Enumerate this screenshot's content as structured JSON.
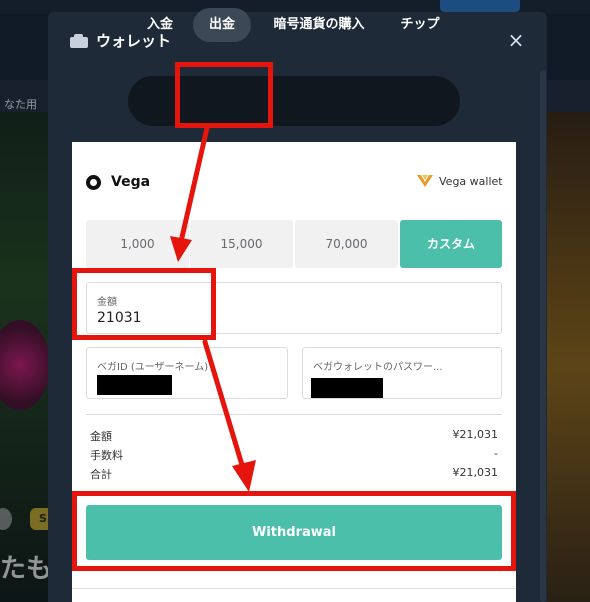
{
  "background": {
    "side_text": "なた用",
    "big_text": "たも",
    "pill_text": "S"
  },
  "modal": {
    "title": "ウォレット",
    "close_label": "×",
    "tabs": [
      {
        "label": "入金"
      },
      {
        "label": "出金"
      },
      {
        "label": "暗号通貨の購入"
      },
      {
        "label": "チップ"
      }
    ],
    "active_tab": "出金"
  },
  "method": {
    "name": "Vega",
    "brand": "Vega wallet"
  },
  "amount_options": [
    "1,000",
    "15,000",
    "70,000",
    "カスタム"
  ],
  "amount_field": {
    "label": "金額",
    "value": "21031"
  },
  "vega_id_field": {
    "label": "ベガID (ユーザーネーム)"
  },
  "vega_password_field": {
    "label": "ベガウォレットのパスワー..."
  },
  "summary": {
    "rows": [
      {
        "label": "金額",
        "value": "¥21,031"
      },
      {
        "label": "手数料",
        "value": "-"
      },
      {
        "label": "合計",
        "value": "¥21,031"
      }
    ]
  },
  "withdraw_button": "Withdrawal",
  "colors": {
    "accent": "#4bbfa9",
    "annotation": "#e5140c",
    "modal_bg": "#1e2a38"
  }
}
